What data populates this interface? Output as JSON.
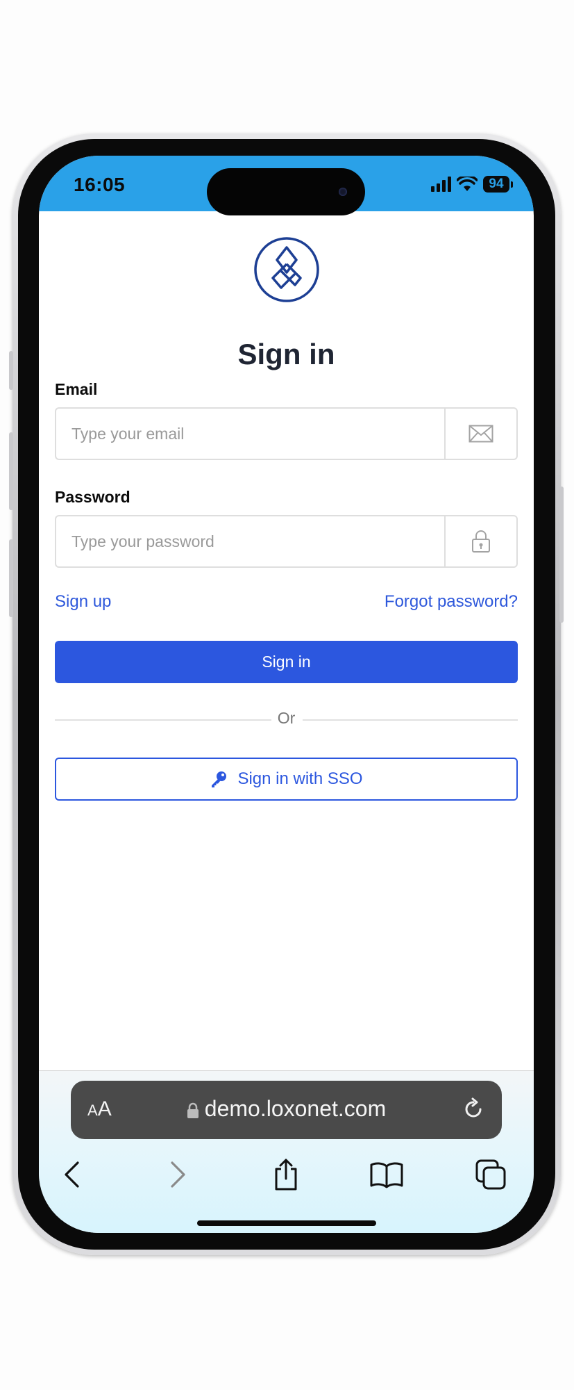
{
  "status_bar": {
    "time": "16:05",
    "battery": "94"
  },
  "page": {
    "title": "Sign in",
    "email": {
      "label": "Email",
      "placeholder": "Type your email"
    },
    "password": {
      "label": "Password",
      "placeholder": "Type your password"
    },
    "signup_link": "Sign up",
    "forgot_link": "Forgot password?",
    "signin_button": "Sign in",
    "divider_text": "Or",
    "sso_button": "Sign in with SSO"
  },
  "browser": {
    "text_size_button": "AA",
    "url": "demo.loxonet.com"
  },
  "colors": {
    "status_bar": "#2aa1e8",
    "primary": "#2c57df",
    "logo": "#1d3f94"
  },
  "icons": {
    "email_addon": "envelope-icon",
    "password_addon": "padlock-icon",
    "sso": "key-icon",
    "toolbar": [
      "back-icon",
      "forward-icon",
      "share-icon",
      "bookmarks-icon",
      "tabs-icon"
    ]
  }
}
